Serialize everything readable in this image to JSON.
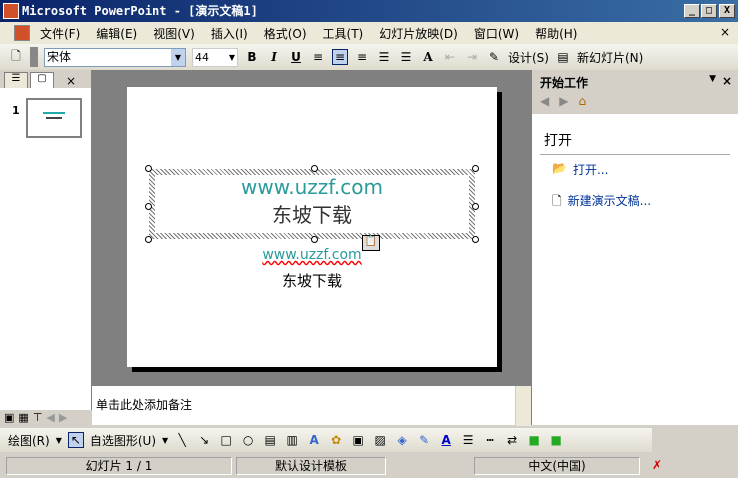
{
  "window": {
    "title": "Microsoft PowerPoint - [演示文稿1]",
    "min": "_",
    "max": "□",
    "close": "X"
  },
  "menu": [
    "文件(F)",
    "编辑(E)",
    "视图(V)",
    "插入(I)",
    "格式(O)",
    "工具(T)",
    "幻灯片放映(D)",
    "窗口(W)",
    "帮助(H)"
  ],
  "menu_close": "×",
  "toolbar": {
    "font": "宋体",
    "size": "44",
    "bold": "B",
    "italic": "I",
    "underline": "U",
    "design": "设计(S)",
    "new_slide": "新幻灯片(N)"
  },
  "left_panel": {
    "slide_number": "1",
    "close": "×"
  },
  "slide": {
    "title_line1": "www.uzzf.com",
    "title_line2": "东坡下载",
    "sub_line1": "www.uzzf.com",
    "sub_line2": "东坡下载"
  },
  "task_pane": {
    "title": "开始工作",
    "section": "打开",
    "open_link": "打开...",
    "new_link": "新建演示文稿..."
  },
  "notes": {
    "placeholder": "单击此处添加备注"
  },
  "draw_toolbar": {
    "draw": "绘图(R)",
    "autoshapes": "自选图形(U)"
  },
  "status": {
    "slide": "幻灯片 1 / 1",
    "template": "默认设计模板",
    "language": "中文(中国)"
  }
}
